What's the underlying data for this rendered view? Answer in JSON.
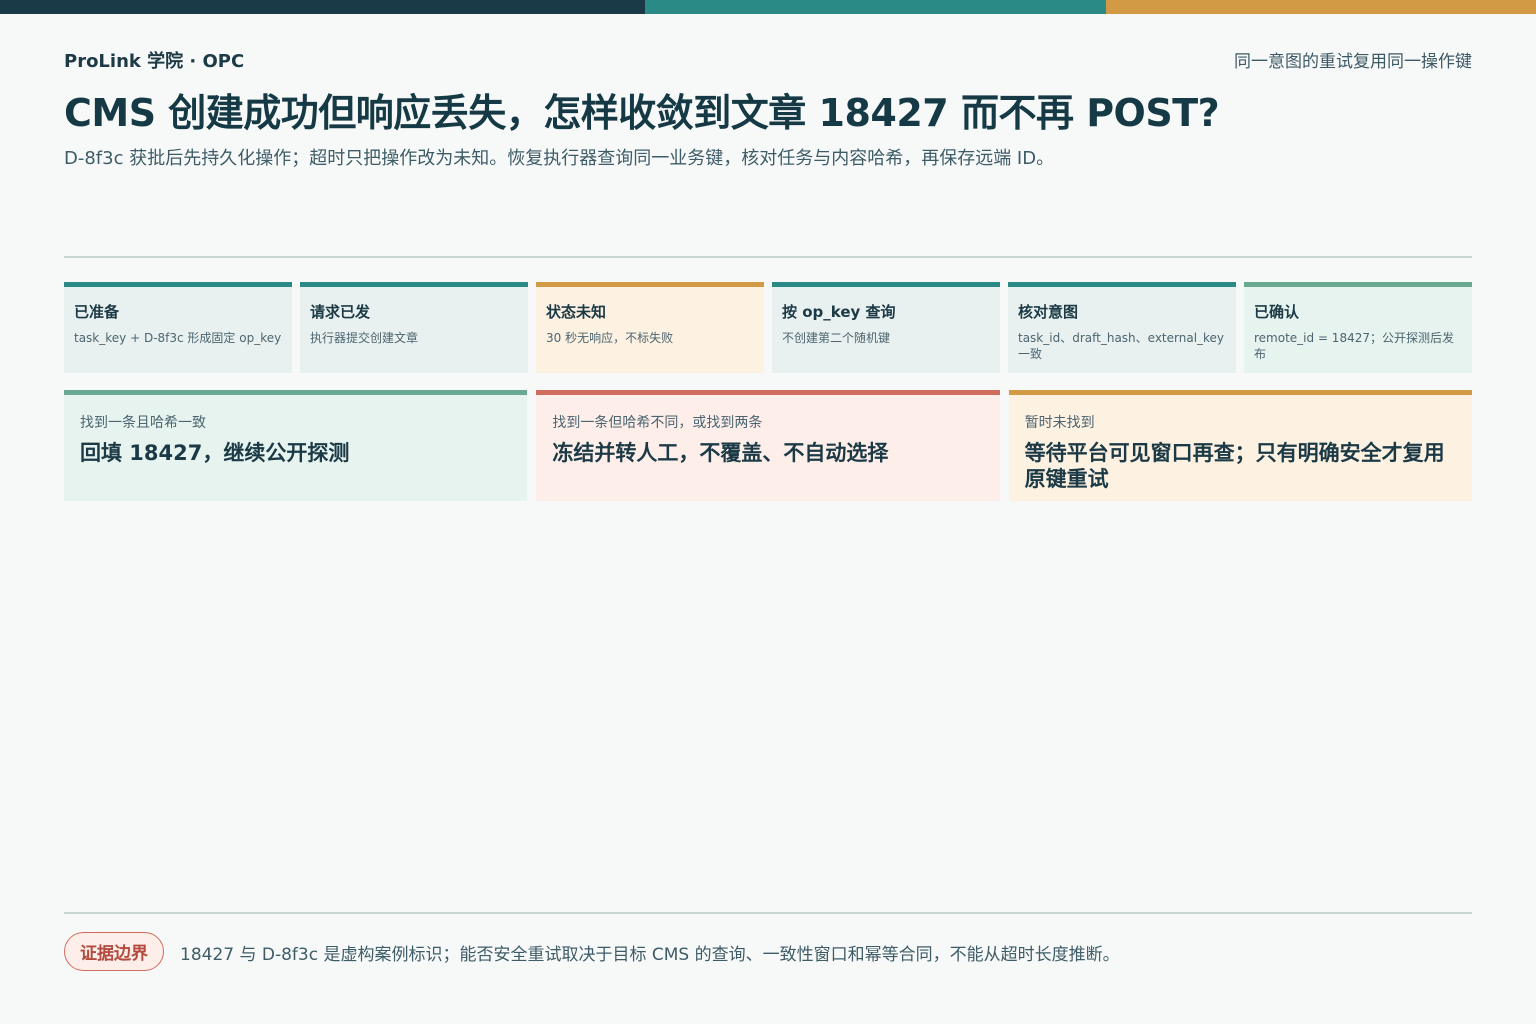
{
  "header": {
    "brand": "ProLink 学院 · OPC",
    "note": "同一意图的重试复用同一操作键",
    "title": "CMS 创建成功但响应丢失，怎样收敛到文章 18427 而不再 POST?",
    "subtitle": "D-8f3c 获批后先持久化操作；超时只把操作改为未知。恢复执行器查询同一业务键，核对任务与内容哈希，再保存远端 ID。"
  },
  "colors": {
    "navy": "#1b3a47",
    "teal": "#2a8b86",
    "amber": "#d39a45",
    "green": "#6aa891",
    "red": "#d16d5e"
  },
  "steps": [
    {
      "title": "已准备",
      "desc": "task_key + D-8f3c 形成固定 op_key"
    },
    {
      "title": "请求已发",
      "desc": "执行器提交创建文章"
    },
    {
      "title": "状态未知",
      "desc": "30 秒无响应，不标失败"
    },
    {
      "title": "按 op_key 查询",
      "desc": "不创建第二个随机键"
    },
    {
      "title": "核对意图",
      "desc": "task_id、draft_hash、external_key 一致"
    },
    {
      "title": "已确认",
      "desc": "remote_id = 18427；公开探测后发布"
    }
  ],
  "outcomes": [
    {
      "condition": "找到一条且哈希一致",
      "action": "回填 18427，继续公开探测"
    },
    {
      "condition": "找到一条但哈希不同，或找到两条",
      "action": "冻结并转人工，不覆盖、不自动选择"
    },
    {
      "condition": "暂时未找到",
      "action": "等待平台可见窗口再查；只有明确安全才复用原键重试"
    }
  ],
  "footer": {
    "badge": "证据边界",
    "note": "18427 与 D-8f3c 是虚构案例标识；能否安全重试取决于目标 CMS 的查询、一致性窗口和幂等合同，不能从超时长度推断。"
  }
}
